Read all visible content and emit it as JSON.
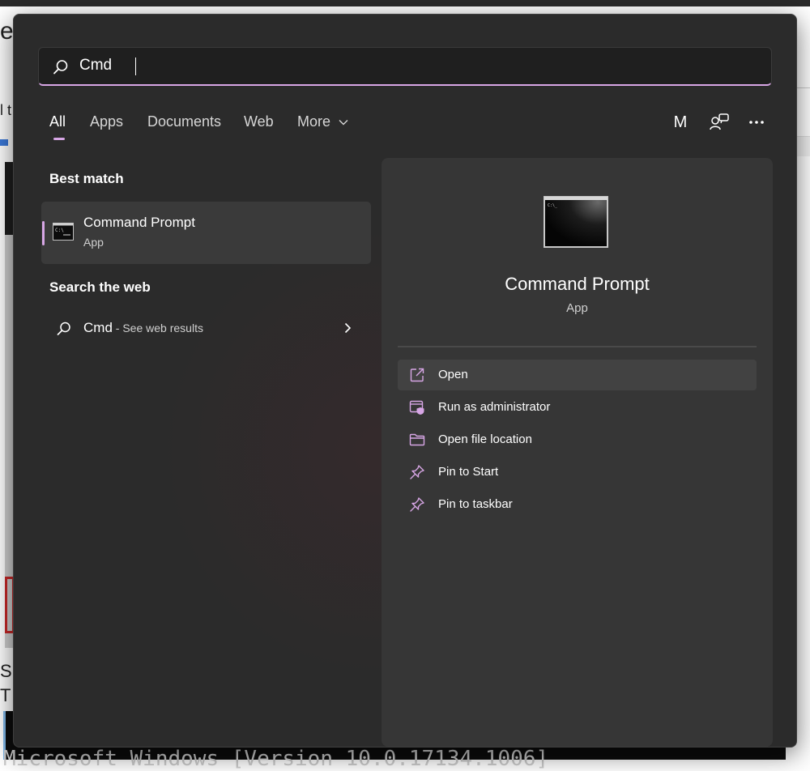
{
  "background": {
    "fragment_title": "e T",
    "fragment_text": "l t",
    "fragment_lines": [
      "S",
      "T"
    ],
    "terminal_line": "Microsoft Windows [Version 10.0.17134.1006]"
  },
  "search": {
    "value": "Cmd"
  },
  "tabs": [
    {
      "label": "All",
      "active": true
    },
    {
      "label": "Apps",
      "active": false
    },
    {
      "label": "Documents",
      "active": false
    },
    {
      "label": "Web",
      "active": false
    },
    {
      "label": "More",
      "active": false
    }
  ],
  "header": {
    "avatar_initial": "M",
    "icons": [
      "people-icon",
      "more-options-icon"
    ]
  },
  "best_match": {
    "title": "Best match",
    "item": {
      "name": "Command Prompt",
      "type": "App",
      "icon": "command-prompt-icon"
    }
  },
  "search_web": {
    "title": "Search the web",
    "item": {
      "query": "Cmd",
      "suffix": " - See web results"
    }
  },
  "detail": {
    "name": "Command Prompt",
    "type": "App",
    "actions": [
      {
        "label": "Open",
        "icon": "open-external-icon"
      },
      {
        "label": "Run as administrator",
        "icon": "shield-window-icon"
      },
      {
        "label": "Open file location",
        "icon": "folder-icon"
      },
      {
        "label": "Pin to Start",
        "icon": "pin-icon"
      },
      {
        "label": "Pin to taskbar",
        "icon": "pin-icon"
      }
    ]
  },
  "colors": {
    "accent": "#d7a6e5",
    "panel": "#2b2b2b",
    "detail_pane": "#363636",
    "selected_item": "#3a3a3a"
  }
}
